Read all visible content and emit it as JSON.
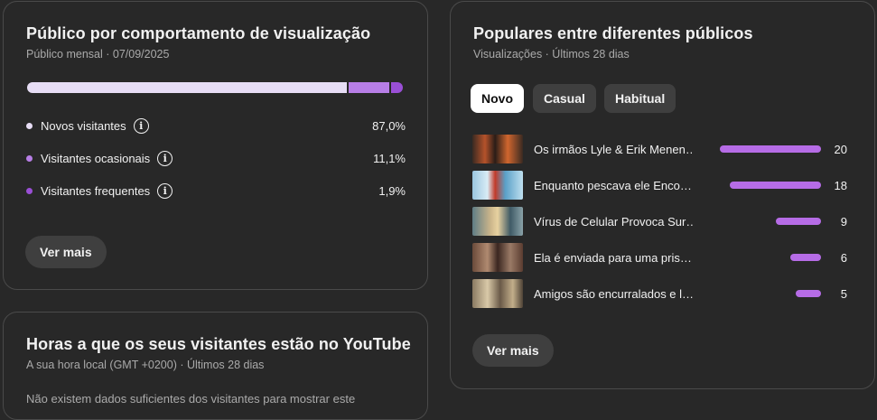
{
  "audience": {
    "title": "Público por comportamento de visualização",
    "subtitle": "Público mensal · 07/09/2025",
    "segments": [
      {
        "label": "Novos visitantes",
        "value": "87,0%",
        "share": 0.87,
        "color": "#e7ddf5"
      },
      {
        "label": "Visitantes ocasionais",
        "value": "11,1%",
        "share": 0.111,
        "color": "#b77ee6"
      },
      {
        "label": "Visitantes frequentes",
        "value": "1,9%",
        "share": 0.019,
        "color": "#9a4fd6"
      }
    ],
    "more_label": "Ver mais"
  },
  "popular": {
    "title": "Populares entre diferentes públicos",
    "subtitle": "Visualizações · Últimos 28 dias",
    "chips": [
      "Novo",
      "Casual",
      "Habitual"
    ],
    "active_chip": "Novo",
    "videos": [
      {
        "title": "Os irmãos Lyle & Erik Menen…",
        "value": 20
      },
      {
        "title": "Enquanto pescava ele Enco…",
        "value": 18
      },
      {
        "title": "Vírus de Celular Provoca Sur…",
        "value": 9
      },
      {
        "title": "Ela é enviada para uma pris…",
        "value": 6
      },
      {
        "title": "Amigos são encurralados e l…",
        "value": 5
      }
    ],
    "max_value": 20,
    "bar_color": "#b66ce6",
    "more_label": "Ver mais"
  },
  "hours": {
    "title": "Horas a que os seus visitantes estão no YouTube",
    "subtitle": "A sua hora local (GMT +0200) · Últimos 28 dias",
    "body": "Não existem dados suficientes dos visitantes para mostrar este"
  }
}
